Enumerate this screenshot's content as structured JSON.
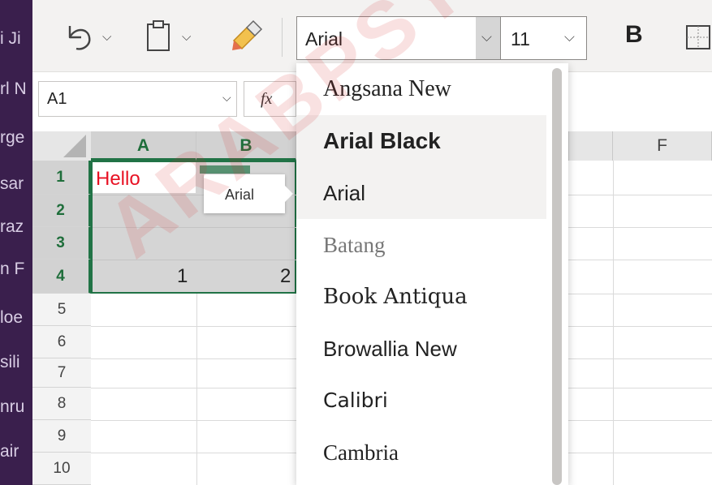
{
  "sidebar_fragments": [
    "i Ji",
    "rl N",
    "rge",
    "sar",
    "raz",
    "n F",
    "loe",
    "sili",
    "nru",
    "air"
  ],
  "toolbar": {
    "undo_icon": "undo-icon",
    "paste_icon": "clipboard-icon",
    "format_painter_icon": "format-painter-icon",
    "font_name": "Arial",
    "font_size": "11",
    "bold_label": "B"
  },
  "formula_bar": {
    "name_box": "A1",
    "fx_label": "fx"
  },
  "columns": [
    "A",
    "B",
    "F"
  ],
  "rows": [
    "1",
    "2",
    "3",
    "4",
    "5",
    "6",
    "7",
    "8",
    "9",
    "10"
  ],
  "cells": {
    "a1": "Hello",
    "a4": "1",
    "b4": "2"
  },
  "tooltip": "Arial",
  "font_list": [
    {
      "label": "Angsana New"
    },
    {
      "label": "Arial Black"
    },
    {
      "label": "Arial"
    },
    {
      "label": "Batang"
    },
    {
      "label": "Book Antiqua"
    },
    {
      "label": "Browallia New"
    },
    {
      "label": "Calibri"
    },
    {
      "label": "Cambria"
    }
  ],
  "watermark": "ARABPSY",
  "colors": {
    "accent_green": "#217346",
    "text_red": "#e81123",
    "sidebar_purple": "#3a1f4d"
  }
}
